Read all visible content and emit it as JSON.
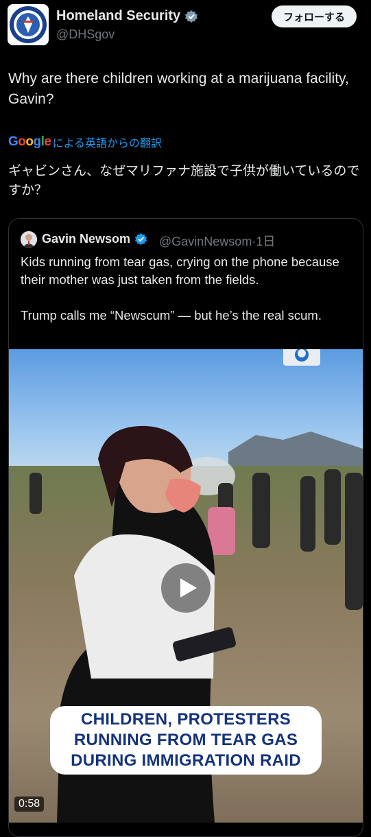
{
  "post": {
    "author_name": "Homeland Security",
    "author_handle": "@DHSgov",
    "follow_label": "フォローする",
    "text": "Why are there children working at a marijuana facility, Gavin?",
    "translation": {
      "provider": "Google",
      "label": "による英語からの翻訳",
      "text": "ギャビンさん、なぜマリファナ施設で子供が働いているのですか？"
    }
  },
  "quoted_post": {
    "author_name": "Gavin Newsom",
    "author_handle": "@GavinNewsom",
    "separator": "·",
    "time": "1日",
    "text": "Kids running from tear gas, crying on the phone because their mother was just taken from the fields.\n\nTrump calls me “Newscum” — but he’s the real scum.",
    "video": {
      "caption_lines": [
        "CHILDREN, PROTESTERS",
        "RUNNING FROM TEAR GAS",
        "DURING IMMIGRATION RAID"
      ],
      "duration": "0:58"
    }
  },
  "icons": [
    "dhs-seal-avatar",
    "verified-badge-gray",
    "verified-badge-blue",
    "play-icon"
  ],
  "colors": {
    "background": "#000000",
    "text": "#e7e9ea",
    "muted": "#71767b",
    "link": "#1d9bf0",
    "caption": "#14337a"
  }
}
